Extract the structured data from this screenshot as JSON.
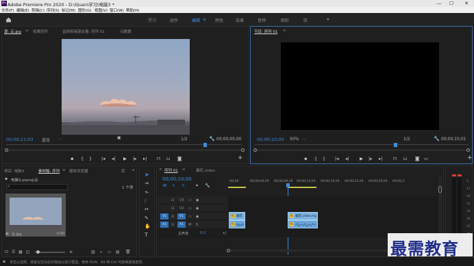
{
  "title_bar": {
    "title": "Adobe Premiere Pro 2020 - D:\\lijuan\\学习\\电脑3 *"
  },
  "window_buttons": [
    "—",
    "☐",
    "✕"
  ],
  "menu": [
    "文件(F)",
    "编辑(E)",
    "剪辑(C)",
    "序列(S)",
    "标记(M)",
    "图形(G)",
    "视图(V)",
    "窗口(W)",
    "帮助(H)"
  ],
  "workspaces": {
    "items": [
      "学习",
      "组件",
      "编辑",
      "颜色",
      "效果",
      "音频",
      "图形",
      "库"
    ],
    "active": "编辑",
    "more": "»"
  },
  "source_panel": {
    "tabs": [
      "源: 云.jpg",
      "效果控件",
      "音频剪辑混合器: 序列 01",
      "元数据"
    ],
    "timecode": "00;00;11;03",
    "fit": "适合",
    "ratio": "1/2",
    "duration": "00;00;05;00"
  },
  "program_panel": {
    "tab": "节目: 序列 01",
    "timecode": "00;00;10;00",
    "zoom": "50%",
    "ratio": "1/2",
    "duration": "00;00;15;01"
  },
  "project_panel": {
    "tabs": [
      "项目: 电脑3",
      "素材箱: 序列",
      "媒体浏览器",
      "库"
    ],
    "bin_path": "电脑3.prproj\\云",
    "item_count": "1 个项",
    "thumb_name": "云.jpg",
    "thumb_duration": "5:00"
  },
  "timeline": {
    "tabs": [
      "序列 01",
      "烟花.video"
    ],
    "timecode": "00;00;10;00",
    "ruler": [
      ";00;00",
      "00;00;04;29",
      "00;00;09;29",
      "00;00;14;29",
      "00;00;19;29",
      "00;00;24;29",
      "00;00;29;29",
      "00;00;3"
    ],
    "tracks": [
      {
        "id": "V3",
        "label": "V3"
      },
      {
        "id": "V2",
        "label": "V2"
      },
      {
        "id": "V1",
        "label": "V1"
      },
      {
        "id": "A1",
        "label": "A1"
      }
    ],
    "master": {
      "label": "主声道",
      "value": "0.0"
    },
    "clips": [
      {
        "name": "烟花",
        "track": "V1",
        "start": 0,
        "end": 2.5
      },
      {
        "name": "烟花.video.mp",
        "track": "V1",
        "start": 10,
        "end": 15
      }
    ],
    "audio_clips": [
      {
        "name": "",
        "start": 0,
        "end": 2.5
      },
      {
        "name": "",
        "start": 10,
        "end": 15
      }
    ]
  },
  "meter_levels": [
    "-6",
    "-12",
    "-18",
    "-24",
    "-30",
    "-36",
    "-42",
    "-48",
    "-54"
  ],
  "status_bar": "单击以选择，或者在空白处并拖动以进行框选。使用 Shift、Alt 和 Ctrl 可获得其他选项。",
  "watermark": "最需教育"
}
